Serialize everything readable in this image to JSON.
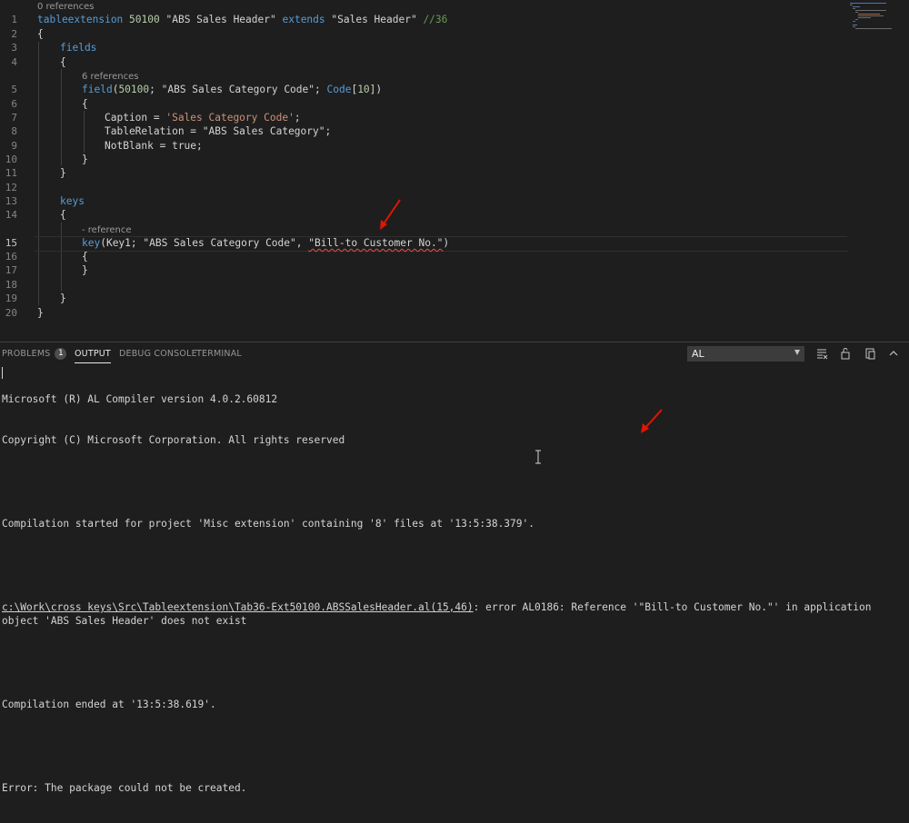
{
  "editor": {
    "codelens": {
      "refs0": "0 references",
      "refs6": "6 references",
      "reference": "- reference"
    },
    "line_numbers": [
      "1",
      "2",
      "3",
      "4",
      "5",
      "6",
      "7",
      "8",
      "9",
      "10",
      "11",
      "12",
      "13",
      "14",
      "15",
      "16",
      "17",
      "18",
      "19",
      "20"
    ],
    "lines": {
      "l1": {
        "kw1": "tableextension",
        "num": "50100",
        "name": "\"ABS Sales Header\"",
        "kw2": "extends",
        "base": "\"Sales Header\"",
        "comment": "//36"
      },
      "l2": "{",
      "l3": "fields",
      "l4": "{",
      "l5": {
        "fn": "field",
        "open": "(",
        "num": "50100",
        "sep": "; ",
        "name": "\"ABS Sales Category Code\"",
        "sep2": "; ",
        "type": "Code",
        "bopen": "[",
        "len": "10",
        "bclose": "])"
      },
      "l6": "{",
      "l7": {
        "prop": "Caption = ",
        "val": "'Sales Category Code'",
        "end": ";"
      },
      "l8": "TableRelation = \"ABS Sales Category\";",
      "l9": "NotBlank = true;",
      "l10": "}",
      "l11": "}",
      "l13": "keys",
      "l14": "{",
      "l15": {
        "fn": "key",
        "pre": "(Key1; \"ABS Sales Category Code\", ",
        "bad": "\"Bill-to Customer No.\"",
        "post": ")"
      },
      "l16": "{",
      "l17": "}",
      "l19": "}",
      "l20": "}"
    }
  },
  "panel": {
    "tabs": {
      "problems": "PROBLEMS",
      "problems_count": "1",
      "output": "OUTPUT",
      "debug_console": "DEBUG CONSOLE",
      "terminal": "TERMINAL"
    },
    "channel": "AL",
    "icons": [
      "clear-output-icon",
      "lock-scroll-icon",
      "open-log-icon",
      "maximize-panel-icon"
    ],
    "output": {
      "line1": "Microsoft (R) AL Compiler version 4.0.2.60812",
      "line2": "Copyright (C) Microsoft Corporation. All rights reserved",
      "line3": "Compilation started for project 'Misc extension' containing '8' files at '13:5:38.379'.",
      "error_path": "c:\\Work\\cross keys\\Src\\Tableextension\\Tab36-Ext50100.ABSSalesHeader.al(15,46)",
      "error_msg": ": error AL0186: Reference '\"Bill-to Customer No.\"' in application object 'ABS Sales Header' does not exist",
      "line5": "Compilation ended at '13:5:38.619'.",
      "line6": "Error: The package could not be created."
    }
  },
  "colors": {
    "background": "#1e1e1e",
    "keyword": "#569cd6",
    "string": "#ce9178",
    "number": "#b5cea8",
    "comment": "#6a9955",
    "annotation_arrow": "#e51400"
  }
}
